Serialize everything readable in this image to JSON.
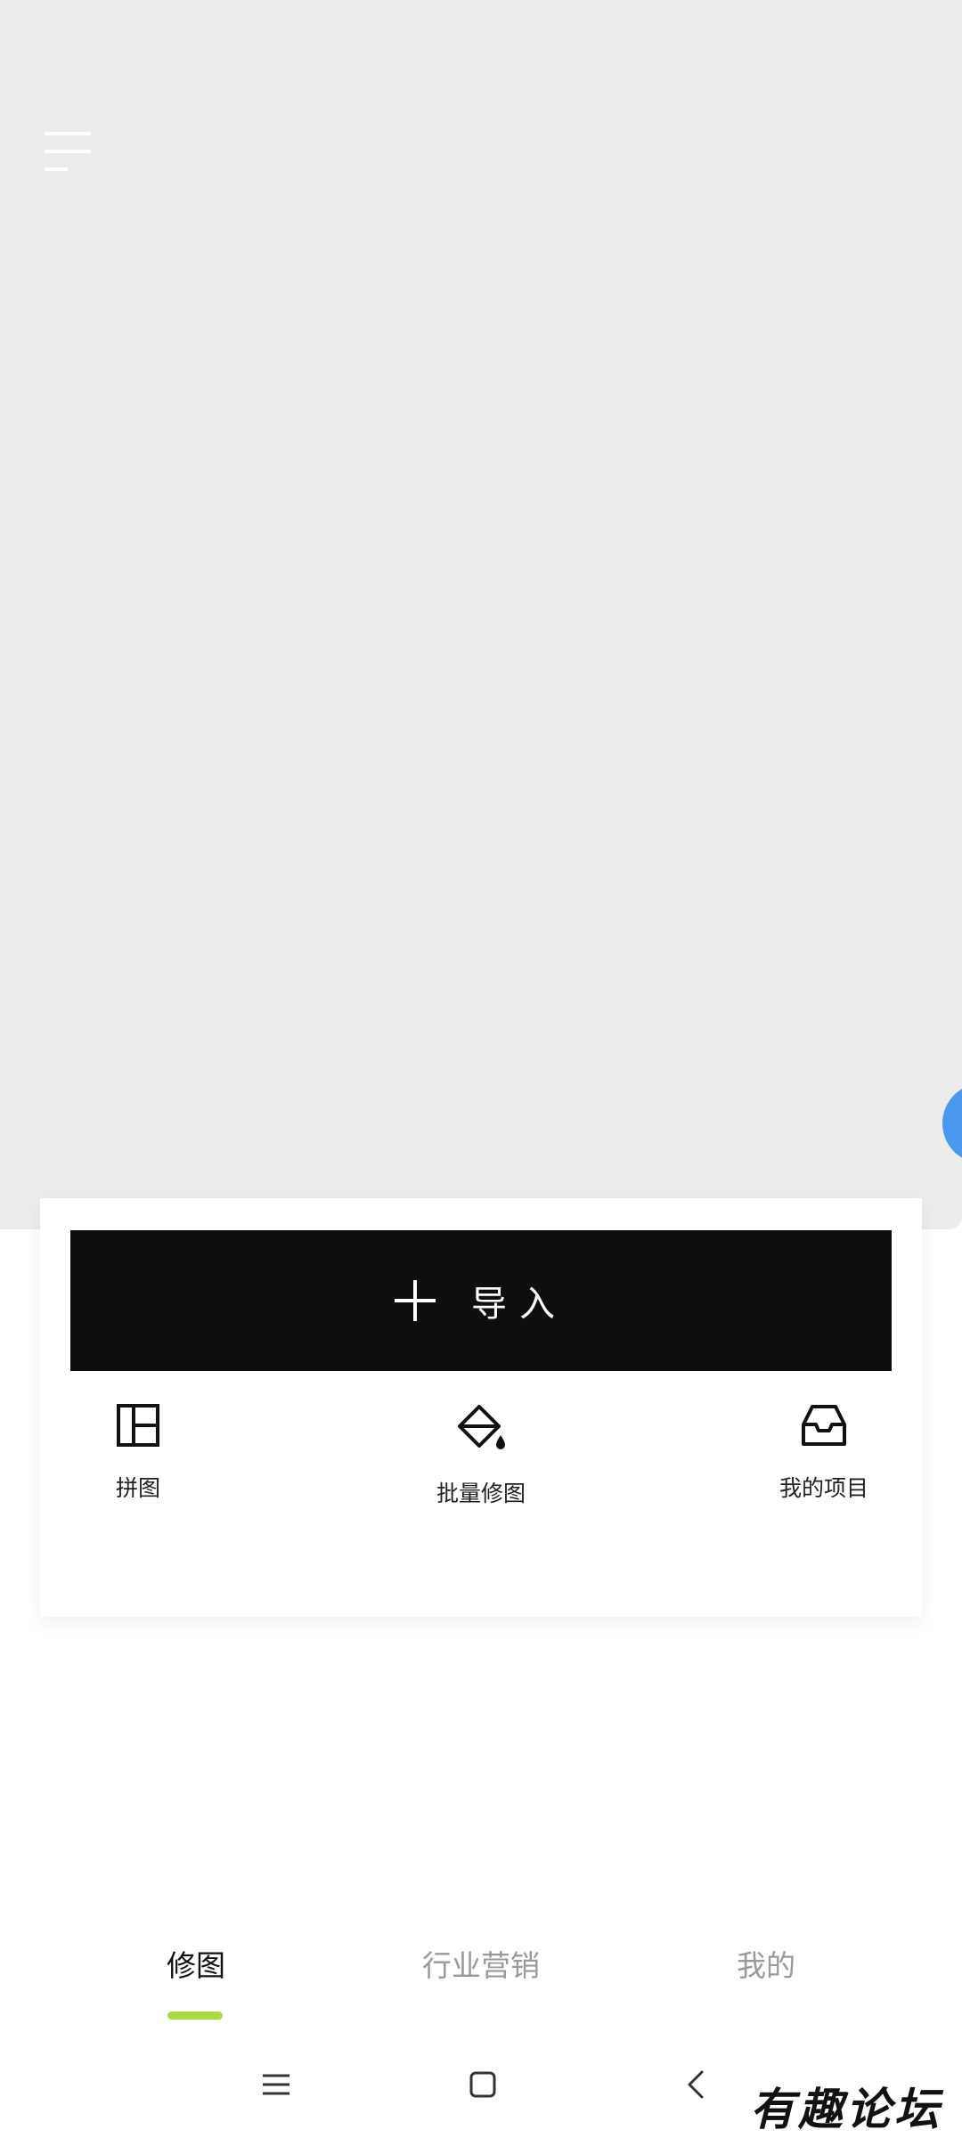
{
  "top": {
    "menu_icon": "hamburger-menu-icon",
    "float_color": "#4a97f0"
  },
  "card": {
    "import_label": "导入",
    "import_icon": "plus-icon",
    "tools": [
      {
        "label": "拼图",
        "icon": "collage-grid-icon"
      },
      {
        "label": "批量修图",
        "icon": "paint-bucket-icon"
      },
      {
        "label": "我的项目",
        "icon": "inbox-tray-icon"
      }
    ]
  },
  "tabs": {
    "items": [
      {
        "label": "修图",
        "active": true
      },
      {
        "label": "行业营销",
        "active": false
      },
      {
        "label": "我的",
        "active": false
      }
    ],
    "indicator_color": "#a8dc3d"
  },
  "system_nav": {
    "menu_icon": "recents-menu-icon",
    "home_icon": "home-square-icon",
    "back_icon": "back-chevron-icon"
  },
  "watermark": "有趣论坛"
}
